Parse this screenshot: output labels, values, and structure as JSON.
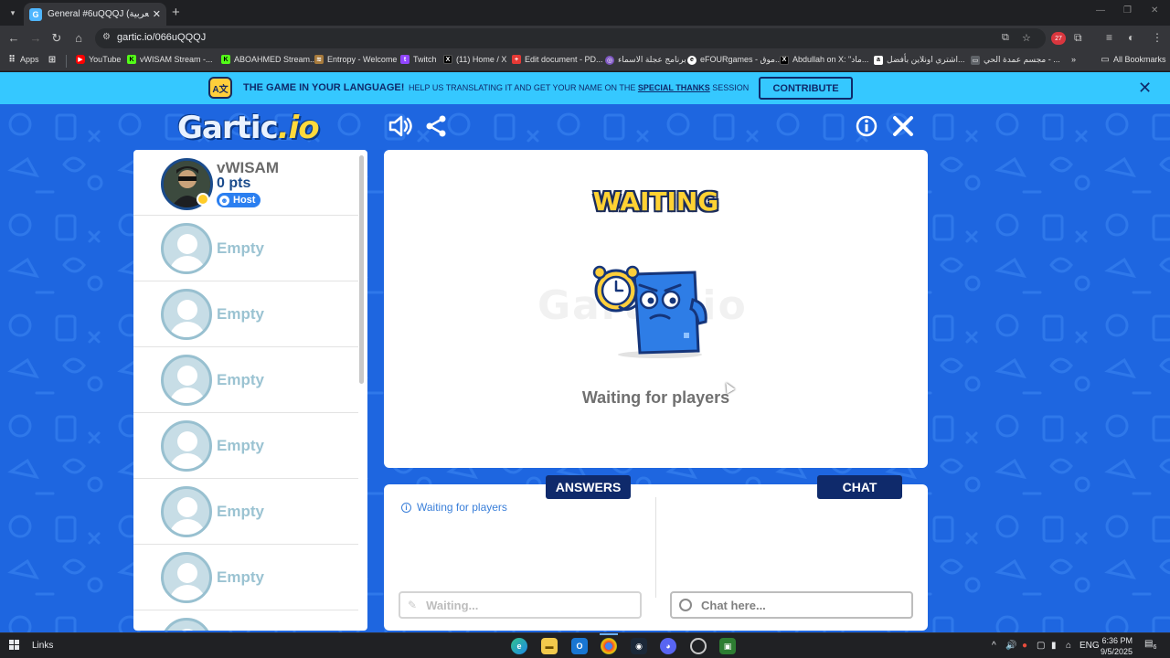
{
  "browser": {
    "tab_title": "General #6uQQQJ (العربية) - Ga",
    "tab_favicon": "G",
    "url": "gartic.io/066uQQQJ",
    "bookmarks": [
      {
        "label": "Apps",
        "icon": "apps-grid-icon",
        "color": "#5f6368"
      },
      {
        "label": "YouTube",
        "icon": "youtube-icon",
        "color": "#ff0000"
      },
      {
        "label": "vWISAM Stream -...",
        "icon": "kick-icon",
        "color": "#53fc18"
      },
      {
        "label": "ABOAHMED Stream...",
        "icon": "kick-icon",
        "color": "#53fc18"
      },
      {
        "label": "Entropy - Welcome",
        "icon": "entropy-icon",
        "color": "#a77a3c"
      },
      {
        "label": "Twitch",
        "icon": "twitch-icon",
        "color": "#9146ff"
      },
      {
        "label": "(11) Home / X",
        "icon": "x-icon",
        "color": "#000000"
      },
      {
        "label": "Edit document - PD...",
        "icon": "pdf-icon",
        "color": "#e53935"
      },
      {
        "label": "برنامج عجلة الاسماء",
        "icon": "wheel-icon",
        "color": "#7e57c2"
      },
      {
        "label": "eFOURgames - موق...",
        "icon": "efour-icon",
        "color": "#ffffff"
      },
      {
        "label": "Abdullah on X: \"ماد...",
        "icon": "x-icon",
        "color": "#000000"
      },
      {
        "label": "اشتري اونلاين بأفضل...",
        "icon": "amazon-icon",
        "color": "#ffffff"
      },
      {
        "label": "مجسم عمدة الحي - ...",
        "icon": "page-icon",
        "color": "#5f6368"
      }
    ],
    "all_bookmarks": "All Bookmarks",
    "extension_badge": "27"
  },
  "banner": {
    "icon_text": "A文",
    "title": "THE GAME IN YOUR LANGUAGE!",
    "text_before": "HELP US TRANSLATING IT AND GET YOUR NAME ON THE ",
    "text_link": "SPECIAL THANKS",
    "text_after": " SESSION",
    "button": "CONTRIBUTE"
  },
  "game": {
    "logo_main": "Gartic",
    "logo_suffix": ".io",
    "host": {
      "name": "vWISAM",
      "points": "0 pts",
      "badge": "Host"
    },
    "empty_slot_label": "Empty",
    "status_title": "WAITING",
    "watermark": "Gartic.io",
    "status_subtitle": "Waiting for players",
    "answers_tab": "ANSWERS",
    "chat_tab": "CHAT",
    "answers_info": "Waiting for players",
    "answer_placeholder": "Waiting...",
    "chat_placeholder": "Chat here..."
  },
  "taskbar": {
    "links": "Links",
    "lang": "ENG",
    "time": "6:36 PM",
    "date": "9/5/2025",
    "notification_count": "6"
  }
}
